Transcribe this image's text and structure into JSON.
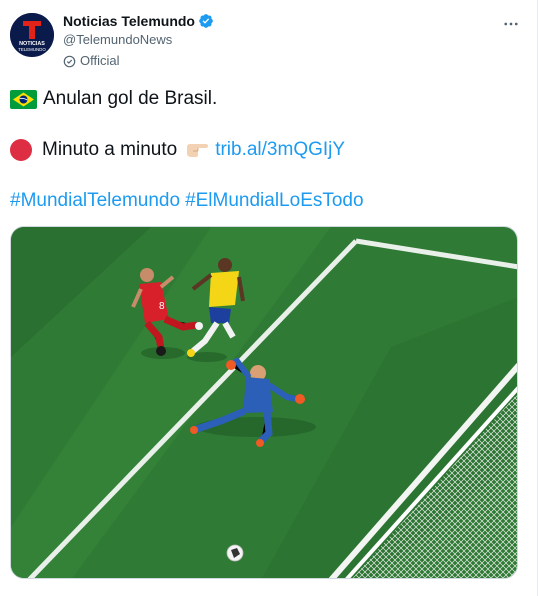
{
  "tweet": {
    "author": {
      "display_name": "Noticias Telemundo",
      "handle": "@TelemundoNews",
      "label": "Official",
      "avatar_text_1": "NOTICIAS",
      "avatar_text_2": "TELEMUNDO"
    },
    "lines": {
      "line1": "Anulan gol de Brasil.",
      "line2_text": "Minuto a minuto",
      "line2_link": "trib.al/3mQGIjY",
      "hashtag1": "#MundialTelemundo",
      "hashtag2": "#ElMundialLoEsTodo"
    },
    "icons": {
      "verified": "verified-badge-icon",
      "official": "official-label-icon",
      "more": "more-options-icon",
      "flag": "brazil-flag-emoji",
      "red_circle": "red-circle-emoji",
      "pointing": "pointing-right-emoji"
    },
    "colors": {
      "link": "#1d9bf0",
      "secondary_text": "#536471",
      "verified": "#1d9bf0",
      "avatar_bg": "#0a1a4a",
      "avatar_logo": "#e2231a"
    }
  }
}
